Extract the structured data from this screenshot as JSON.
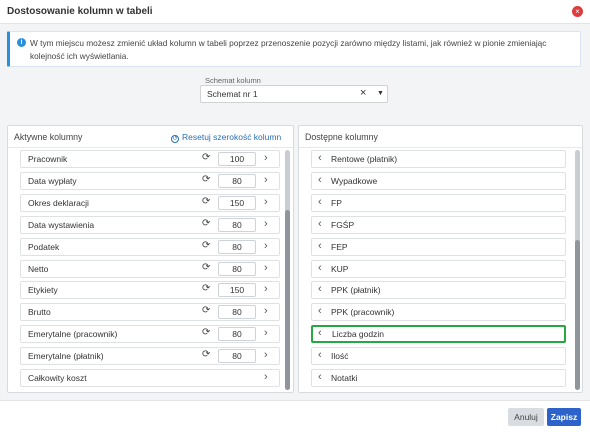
{
  "dialog": {
    "title": "Dostosowanie kolumn w tabeli",
    "close_icon": "×"
  },
  "info": {
    "icon": "i",
    "text": "W tym miejscu możesz zmienić układ kolumn w tabeli poprzez przenoszenie pozycji zarówno między listami, jak również w pionie zmieniając kolejność ich wyświetlania."
  },
  "schema": {
    "label": "Schemat kolumn",
    "value": "Schemat nr 1",
    "clear_icon": "×",
    "caret_icon": "▼"
  },
  "active": {
    "title": "Aktywne kolumny",
    "reset_label": "Resetuj szerokość kolumn",
    "items": [
      {
        "label": "Pracownik",
        "width": "100"
      },
      {
        "label": "Data wypłaty",
        "width": "80"
      },
      {
        "label": "Okres deklaracji",
        "width": "150"
      },
      {
        "label": "Data wystawienia",
        "width": "80"
      },
      {
        "label": "Podatek",
        "width": "80"
      },
      {
        "label": "Netto",
        "width": "80"
      },
      {
        "label": "Etykiety",
        "width": "150"
      },
      {
        "label": "Brutto",
        "width": "80"
      },
      {
        "label": "Emerytalne (pracownik)",
        "width": "80"
      },
      {
        "label": "Emerytalne (płatnik)",
        "width": "80"
      },
      {
        "label": "Całkowity koszt"
      }
    ]
  },
  "available": {
    "title": "Dostępne kolumny",
    "items": [
      {
        "label": "Rentowe (płatnik)"
      },
      {
        "label": "Wypadkowe"
      },
      {
        "label": "FP"
      },
      {
        "label": "FGŚP"
      },
      {
        "label": "FEP"
      },
      {
        "label": "KUP"
      },
      {
        "label": "PPK (płatnik)"
      },
      {
        "label": "PPK (pracownik)"
      },
      {
        "label": "Liczba godzin",
        "highlighted": true
      },
      {
        "label": "Ilość"
      },
      {
        "label": "Notatki"
      }
    ]
  },
  "footer": {
    "cancel_label": "Anuluj",
    "save_label": "Zapisz"
  },
  "colors": {
    "accent": "#2c62c9",
    "link": "#2a6fb3",
    "highlight": "#28a745",
    "close": "#e03b3b"
  },
  "glyphs": {
    "chevron_left": "‹",
    "chevron_right": "›",
    "refresh": "⟳"
  }
}
